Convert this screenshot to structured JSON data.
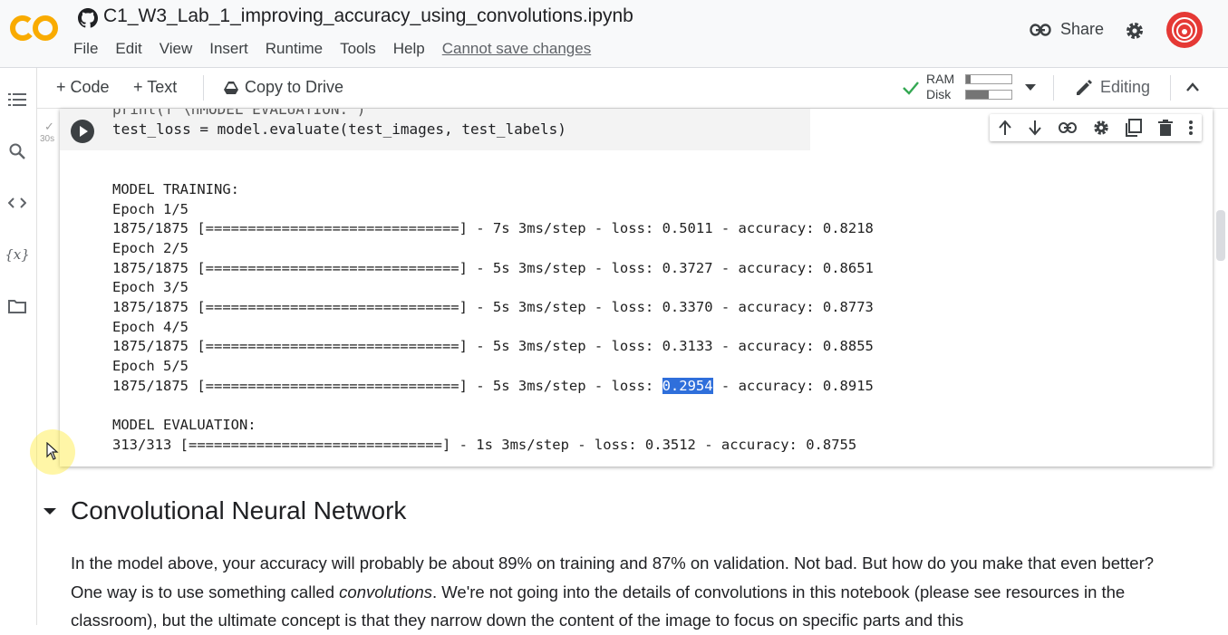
{
  "header": {
    "title": "C1_W3_Lab_1_improving_accuracy_using_convolutions.ipynb",
    "menu": [
      "File",
      "Edit",
      "View",
      "Insert",
      "Runtime",
      "Tools",
      "Help"
    ],
    "unsaved_notice": "Cannot save changes",
    "share_label": "Share"
  },
  "toolbar": {
    "add_code": "+ Code",
    "add_text": "+ Text",
    "copy_to_drive": "Copy to Drive",
    "ram_label": "RAM",
    "disk_label": "Disk",
    "ram_fraction": 0.1,
    "disk_fraction": 0.5,
    "editing_label": "Editing"
  },
  "cell": {
    "run_time": "30s",
    "code_prev": "print(f'\\nMODEL EVALUATION:')",
    "code_current": "test_loss = model.evaluate(test_images, test_labels)",
    "output": {
      "training_header": "MODEL TRAINING:",
      "epochs": [
        {
          "epoch": "Epoch 1/5",
          "line": "1875/1875 [==============================] - 7s 3ms/step - loss: 0.5011 - accuracy: 0.8218"
        },
        {
          "epoch": "Epoch 2/5",
          "line": "1875/1875 [==============================] - 5s 3ms/step - loss: 0.3727 - accuracy: 0.8651"
        },
        {
          "epoch": "Epoch 3/5",
          "line": "1875/1875 [==============================] - 5s 3ms/step - loss: 0.3370 - accuracy: 0.8773"
        },
        {
          "epoch": "Epoch 4/5",
          "line": "1875/1875 [==============================] - 5s 3ms/step - loss: 0.3133 - accuracy: 0.8855"
        },
        {
          "epoch": "Epoch 5/5",
          "line_prefix": "1875/1875 [==============================] - 5s 3ms/step - loss: ",
          "line_highlight": "0.2954",
          "line_suffix": " - accuracy: 0.8915"
        }
      ],
      "evaluation_header": "MODEL EVALUATION:",
      "evaluation_line": "313/313 [==============================] - 1s 3ms/step - loss: 0.3512 - accuracy: 0.8755"
    }
  },
  "markdown": {
    "heading": "Convolutional Neural Network",
    "para_part1": "In the model above, your accuracy will probably be about 89% on training and 87% on validation. Not bad. But how do you make that even better? One way is to use something called ",
    "para_em": "convolutions",
    "para_part2": ". We're not going into the details of convolutions in this notebook (please see resources in the classroom), but the ultimate concept is that they narrow down the content of the image to focus on specific parts and this"
  },
  "icons": {
    "sidebar": [
      "table-of-contents-icon",
      "search-icon",
      "code-snippets-icon",
      "variables-icon",
      "files-icon"
    ],
    "cell_toolbar": [
      "move-up-icon",
      "move-down-icon",
      "link-icon",
      "settings-icon",
      "mirror-cell-icon",
      "delete-icon",
      "more-icon"
    ]
  },
  "colors": {
    "accent": "#f9ab00",
    "highlight": "#2f6fdb"
  }
}
